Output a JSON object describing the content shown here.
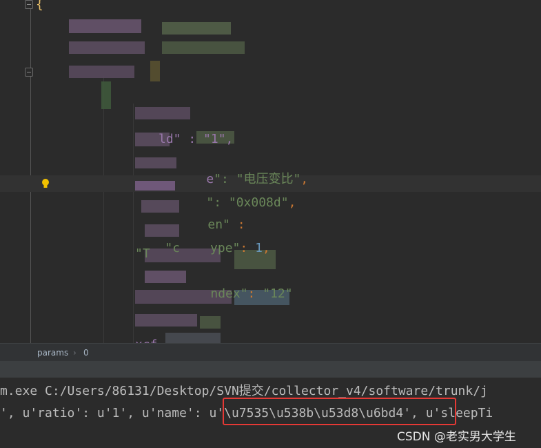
{
  "code": {
    "open_brace": "{",
    "line_ratio": {
      "key_tail": "e",
      "quote_colon": "\": ",
      "value": "\"电压变比\"",
      "comma": ","
    },
    "line_addr": {
      "key_tail": "",
      "quote_colon": "\": ",
      "value": "\"0x008d\"",
      "comma": ","
    },
    "line_len": {
      "key_tail": "en\"",
      "colon": " :"
    },
    "line_type": {
      "key_prefix": "\"c",
      "key_tail": "ype\"",
      "colon": ": ",
      "value": "1",
      "comma": ","
    },
    "line_index": {
      "key_tail": "ndex\"",
      "colon": ": ",
      "value": "\"12\""
    },
    "line_partial_1": "ld\" : \"1\",",
    "line_partial_2": "\"T",
    "line_partial_3": "xcf"
  },
  "breadcrumb": {
    "item_1": "params",
    "separator": "›",
    "item_2": "0"
  },
  "console": {
    "line_1": "m.exe C:/Users/86131/Desktop/SVN提交/collector_v4/software/trunk/j",
    "line_2_prefix": "', u'ratio': u'1', u'name': ",
    "line_2_highlight": "u'\\u7535\\u538b\\u53d8\\u6bd4'",
    "line_2_suffix": ", u'sleepTi"
  },
  "watermark": "CSDN @老实男大学生",
  "colors": {
    "background": "#2b2b2b",
    "string": "#6a8759",
    "punctuation": "#cc7832",
    "number": "#6897bb",
    "highlight_box": "#e53935"
  }
}
